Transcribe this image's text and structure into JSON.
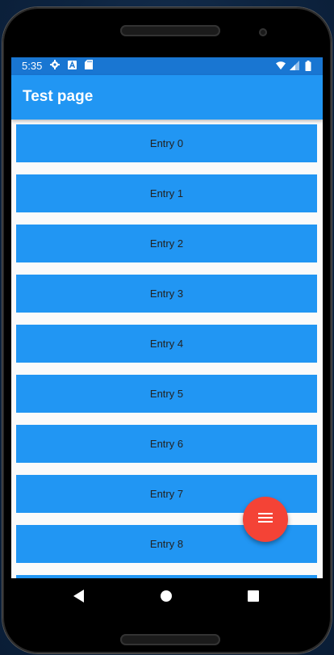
{
  "status_bar": {
    "time": "5:35",
    "left_icons": [
      "settings-icon",
      "a-box-icon",
      "sd-card-icon"
    ],
    "right_icons": [
      "wifi-icon",
      "signal-icon",
      "battery-icon"
    ]
  },
  "app_bar": {
    "title": "Test page"
  },
  "list": {
    "items": [
      {
        "label": "Entry 0"
      },
      {
        "label": "Entry 1"
      },
      {
        "label": "Entry 2"
      },
      {
        "label": "Entry 3"
      },
      {
        "label": "Entry 4"
      },
      {
        "label": "Entry 5"
      },
      {
        "label": "Entry 6"
      },
      {
        "label": "Entry 7"
      },
      {
        "label": "Entry 8"
      }
    ]
  },
  "fab": {
    "icon": "menu-icon"
  },
  "nav_bar": {
    "buttons": [
      "back-icon",
      "home-icon",
      "recents-icon"
    ]
  },
  "colors": {
    "status_bar": "#1976d2",
    "app_bar": "#2196f3",
    "entry": "#2196f3",
    "fab": "#f44336",
    "list_background": "#fafafa"
  }
}
